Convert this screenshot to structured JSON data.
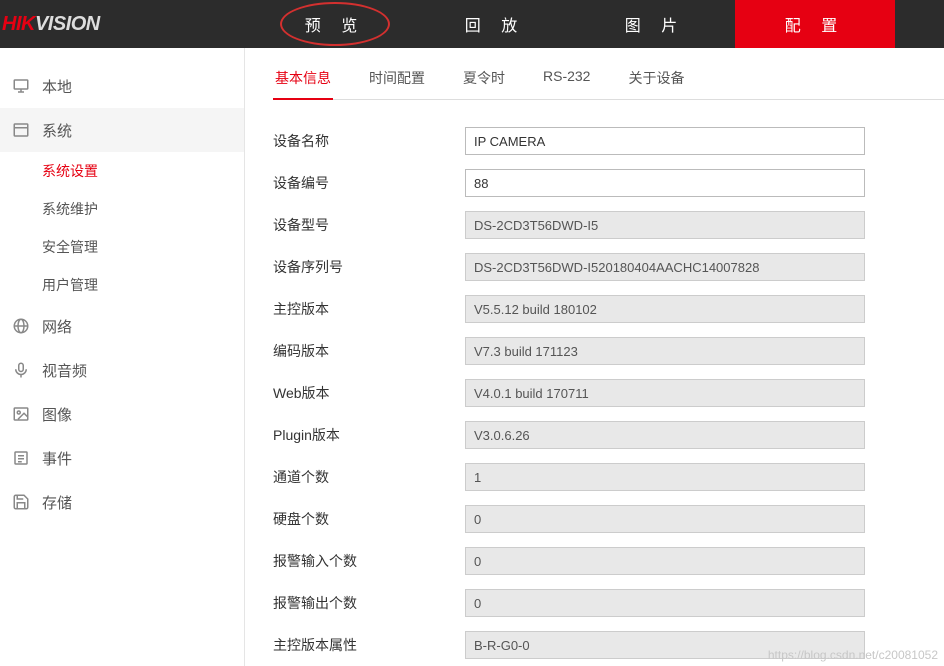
{
  "logo": {
    "part1": "HIK",
    "part2": "VISION"
  },
  "nav": {
    "items": [
      {
        "label": "预 览"
      },
      {
        "label": "回 放"
      },
      {
        "label": "图 片"
      },
      {
        "label": "配 置"
      }
    ]
  },
  "sidebar": {
    "items": [
      {
        "label": "本地"
      },
      {
        "label": "系统"
      },
      {
        "label": "网络"
      },
      {
        "label": "视音频"
      },
      {
        "label": "图像"
      },
      {
        "label": "事件"
      },
      {
        "label": "存储"
      }
    ],
    "system_sub": [
      {
        "label": "系统设置"
      },
      {
        "label": "系统维护"
      },
      {
        "label": "安全管理"
      },
      {
        "label": "用户管理"
      }
    ]
  },
  "tabs": {
    "items": [
      {
        "label": "基本信息"
      },
      {
        "label": "时间配置"
      },
      {
        "label": "夏令时"
      },
      {
        "label": "RS-232"
      },
      {
        "label": "关于设备"
      }
    ]
  },
  "form": {
    "rows": [
      {
        "label": "设备名称",
        "value": "IP CAMERA",
        "editable": true
      },
      {
        "label": "设备编号",
        "value": "88",
        "editable": true
      },
      {
        "label": "设备型号",
        "value": "DS-2CD3T56DWD-I5",
        "editable": false
      },
      {
        "label": "设备序列号",
        "value": "DS-2CD3T56DWD-I520180404AACHC14007828",
        "editable": false
      },
      {
        "label": "主控版本",
        "value": "V5.5.12 build 180102",
        "editable": false
      },
      {
        "label": "编码版本",
        "value": "V7.3 build 171123",
        "editable": false
      },
      {
        "label": "Web版本",
        "value": "V4.0.1 build 170711",
        "editable": false
      },
      {
        "label": "Plugin版本",
        "value": "V3.0.6.26",
        "editable": false
      },
      {
        "label": "通道个数",
        "value": "1",
        "editable": false
      },
      {
        "label": "硬盘个数",
        "value": "0",
        "editable": false
      },
      {
        "label": "报警输入个数",
        "value": "0",
        "editable": false
      },
      {
        "label": "报警输出个数",
        "value": "0",
        "editable": false
      },
      {
        "label": "主控版本属性",
        "value": "B-R-G0-0",
        "editable": false
      }
    ]
  },
  "watermark": "https://blog.csdn.net/c20081052"
}
